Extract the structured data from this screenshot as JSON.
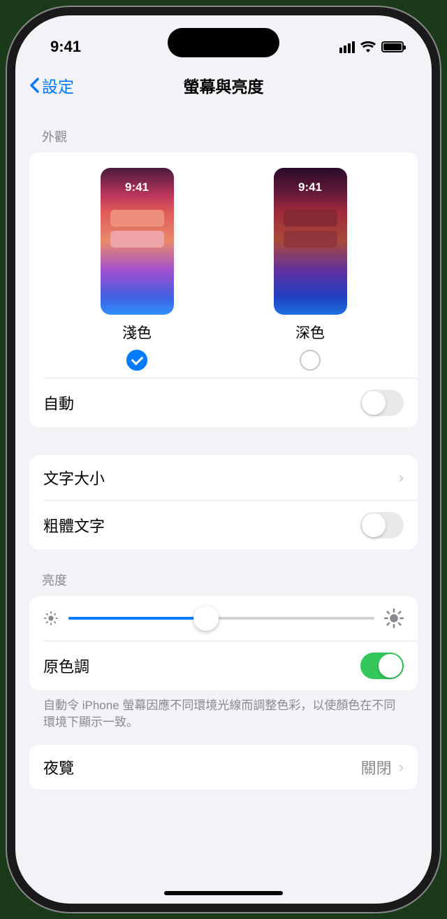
{
  "status": {
    "time": "9:41"
  },
  "nav": {
    "back": "設定",
    "title": "螢幕與亮度"
  },
  "appearance": {
    "header": "外觀",
    "light_label": "淺色",
    "dark_label": "深色",
    "preview_time": "9:41",
    "auto_label": "自動"
  },
  "text": {
    "size_label": "文字大小",
    "bold_label": "粗體文字"
  },
  "brightness": {
    "header": "亮度",
    "truetone_label": "原色調",
    "truetone_desc": "自動令 iPhone 螢幕因應不同環境光線而調整色彩，以使顏色在不同環境下顯示一致。"
  },
  "nightshift": {
    "label": "夜覽",
    "value": "關閉"
  }
}
